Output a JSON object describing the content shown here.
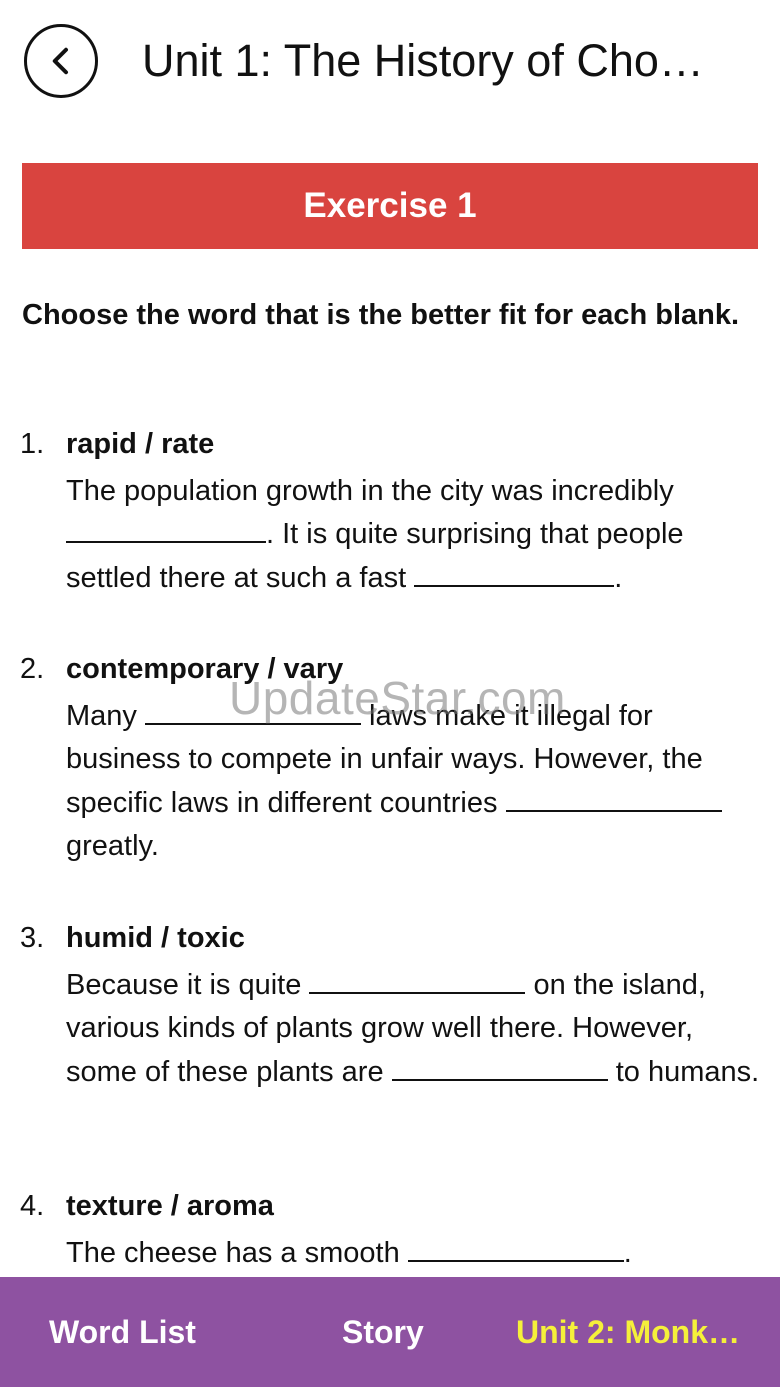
{
  "header": {
    "title": "Unit 1: The History of Cho…"
  },
  "banner": {
    "label": "Exercise 1",
    "color": "#d9443f"
  },
  "instructions": "Choose the word that is the better fit for each blank.",
  "questions": [
    {
      "number": "1.",
      "words": "rapid / rate",
      "parts": [
        "The population growth in the city was incredibly ",
        ". It is quite surprising that people settled there at such a fast ",
        "."
      ]
    },
    {
      "number": "2.",
      "words": "contemporary / vary",
      "parts": [
        "Many ",
        " laws make it illegal for business to compete in unfair ways. However, the specific laws in different countries ",
        " greatly."
      ]
    },
    {
      "number": "3.",
      "words": "humid / toxic",
      "parts": [
        "Because it is quite ",
        " on the island, various kinds of plants grow well there. However, some of these plants are ",
        " to humans."
      ]
    },
    {
      "number": "4.",
      "words": "texture / aroma",
      "parts": [
        "The cheese has a smooth ",
        "."
      ]
    }
  ],
  "watermark": "UpdateStar.com",
  "bottom_nav": {
    "word_list": "Word List",
    "story": "Story",
    "next_unit": "Unit 2: Monk…",
    "bar_color": "#8e52a1",
    "next_color": "#f5f03a"
  }
}
